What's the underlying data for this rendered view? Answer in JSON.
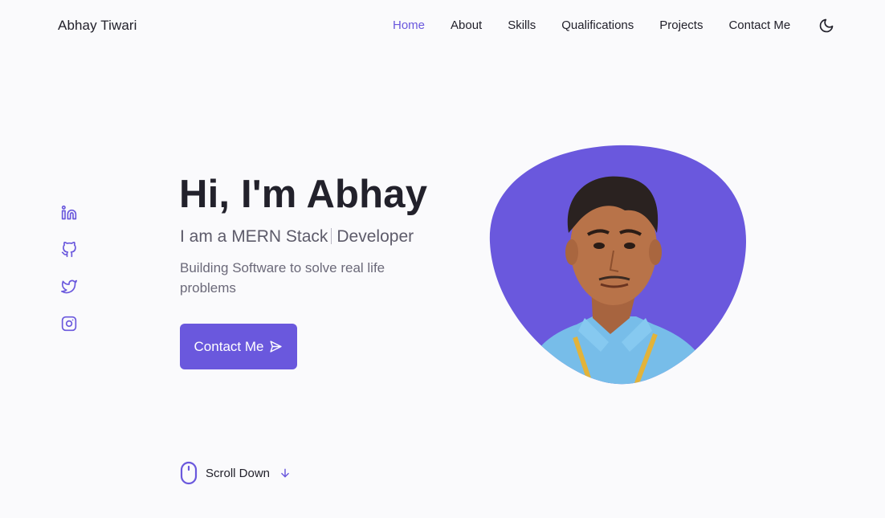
{
  "header": {
    "brand": "Abhay Tiwari",
    "nav": [
      {
        "label": "Home",
        "active": true
      },
      {
        "label": "About"
      },
      {
        "label": "Skills"
      },
      {
        "label": "Qualifications"
      },
      {
        "label": "Projects"
      },
      {
        "label": "Contact Me"
      }
    ],
    "theme_icon": "moon-icon"
  },
  "social": [
    "linkedin-icon",
    "github-icon",
    "twitter-icon",
    "instagram-icon"
  ],
  "hero": {
    "title": "Hi, I'm Abhay",
    "subtitle_prefix": "I am a MERN Stack",
    "subtitle_suffix": "Developer",
    "description": "Building Software to solve real life problems",
    "cta_label": "Contact Me",
    "cta_icon": "send-icon"
  },
  "scroll": {
    "label": "Scroll Down",
    "icon": "mouse-icon",
    "arrow_icon": "arrow-down-icon"
  },
  "colors": {
    "accent": "#6a58dd",
    "text": "#22212b",
    "background": "#fafafc"
  }
}
